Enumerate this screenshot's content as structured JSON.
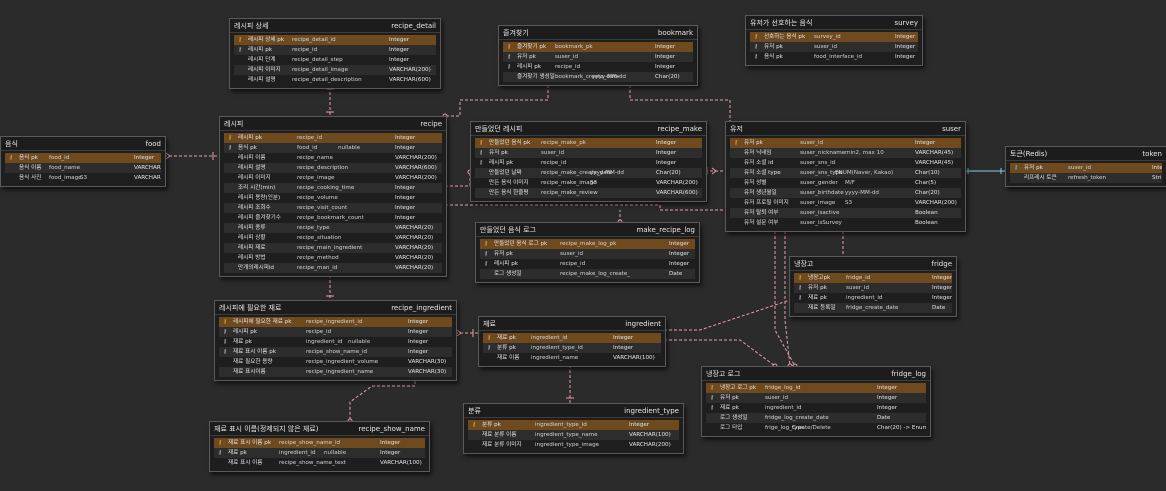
{
  "colors": {
    "background": "#2b2b2b",
    "table_bg": "#1e1e1e",
    "pk_row": "#6e4a1e",
    "relation_line": "#e8a0a8",
    "redis_line": "#7fd0dc"
  },
  "tables": [
    {
      "id": "recipe_detail",
      "title_ko": "레시피 상세",
      "title_en": "recipe_detail",
      "columns": [
        {
          "key": "pk",
          "name": "레시피 상세 pk",
          "col": "recipe_detail_id",
          "type": "Integer"
        },
        {
          "key": "fk",
          "name": "레시피 pk",
          "col": "recipe_id",
          "type": "Integer"
        },
        {
          "key": "",
          "name": "레시피 단계",
          "col": "recipe_detail_step",
          "type": "Integer"
        },
        {
          "key": "",
          "name": "레시피 이미지",
          "col": "recipe_detail_image",
          "type": "VARCHAR(200)"
        },
        {
          "key": "",
          "name": "레시피 설명",
          "col": "recipe_detail_description",
          "type": "VARCHAR(600)"
        }
      ]
    },
    {
      "id": "bookmark",
      "title_ko": "즐겨찾기",
      "title_en": "bookmark",
      "columns": [
        {
          "key": "pk",
          "name": "즐겨찾기 pk",
          "col": "bookmark_pk",
          "type": "Integer"
        },
        {
          "key": "fk",
          "name": "유저 pk",
          "col": "suser_id",
          "type": "Integer"
        },
        {
          "key": "fk",
          "name": "레시피 pk",
          "col": "recipe_id",
          "type": "Integer"
        },
        {
          "key": "",
          "name": "즐겨찾기 생성일",
          "col": "bookmark_create_date",
          "def": "yyyy-MM-dd",
          "type": "Char(20)"
        }
      ]
    },
    {
      "id": "survey",
      "title_ko": "유저가 선호하는 음식",
      "title_en": "survey",
      "columns": [
        {
          "key": "pk",
          "name": "선호하는 음식 pk",
          "col": "survey_id",
          "type": "Integer"
        },
        {
          "key": "fk",
          "name": "유저 pk",
          "col": "suser_id",
          "type": "Integer"
        },
        {
          "key": "fk",
          "name": "음식 pk",
          "col": "food_interface_id",
          "type": "Integer"
        }
      ]
    },
    {
      "id": "food",
      "title_ko": "음식",
      "title_en": "food",
      "columns": [
        {
          "key": "pk",
          "name": "음식 pk",
          "col": "food_id",
          "type": "Integer"
        },
        {
          "key": "",
          "name": "음식 이름",
          "col": "food_name",
          "type": "VARCHAR(200)"
        },
        {
          "key": "",
          "name": "음식 사진",
          "col": "food_image",
          "def": "S3",
          "type": "VARCHAR(200)"
        }
      ]
    },
    {
      "id": "recipe",
      "title_ko": "레시피",
      "title_en": "recipe",
      "columns": [
        {
          "key": "pk",
          "name": "레시피 pk",
          "col": "recipe_id",
          "type": "Integer"
        },
        {
          "key": "fk",
          "name": "음식 pk",
          "col": "food_id",
          "null": "nullable",
          "type": "Integer"
        },
        {
          "key": "",
          "name": "레시피 이름",
          "col": "recipe_name",
          "type": "VARCHAR(200)"
        },
        {
          "key": "",
          "name": "레시피 설명",
          "col": "recipe_description",
          "type": "VARCHAR(600)"
        },
        {
          "key": "",
          "name": "레시피 이미지",
          "col": "recipe_image",
          "type": "VARCHAR(200)"
        },
        {
          "key": "",
          "name": "조리 시간(min)",
          "col": "recipe_cooking_time",
          "type": "Integer"
        },
        {
          "key": "",
          "name": "레시피 용량(인분)",
          "col": "recipe_volume",
          "type": "Integer"
        },
        {
          "key": "",
          "name": "레시피 조회수",
          "col": "recipe_visit_count",
          "type": "Integer"
        },
        {
          "key": "",
          "name": "레시피 즐겨찾기수",
          "col": "recipe_bookmark_count",
          "type": "Integer"
        },
        {
          "key": "",
          "name": "레시피 종류",
          "col": "recipe_type",
          "type": "VARCHAR(20)"
        },
        {
          "key": "",
          "name": "레시피 상황",
          "col": "recipe_situation",
          "type": "VARCHAR(20)"
        },
        {
          "key": "",
          "name": "레시피 재료",
          "col": "recipe_main_ingredient",
          "type": "VARCHAR(20)"
        },
        {
          "key": "",
          "name": "레시피 방법",
          "col": "recipe_method",
          "type": "VARCHAR(20)"
        },
        {
          "key": "",
          "name": "만개의레시피id",
          "col": "recipe_man_id",
          "type": "VARCHAR(20)"
        }
      ]
    },
    {
      "id": "recipe_make",
      "title_ko": "만들었던 레시피",
      "title_en": "recipe_make",
      "columns": [
        {
          "key": "pk",
          "name": "만들었던 음식 pk",
          "col": "recipe_make_pk",
          "type": "Integer"
        },
        {
          "key": "fk",
          "name": "유저 pk",
          "col": "suser_id",
          "type": "Integer"
        },
        {
          "key": "fk",
          "name": "레시피 pk",
          "col": "recipe_id",
          "type": "Integer"
        },
        {
          "key": "",
          "name": "만들었던 날짜",
          "col": "recipe_make_create_date",
          "def": "yyyy-MM-dd",
          "type": "Char(20)"
        },
        {
          "key": "",
          "name": "만든 음식 이미지",
          "col": "recipe_make_image",
          "def": "S3",
          "type": "VARCHAR(200)"
        },
        {
          "key": "",
          "name": "만든 음식 한줄평",
          "col": "recipe_make_review",
          "type": "VARCHAR(600)"
        }
      ]
    },
    {
      "id": "suser",
      "title_ko": "유저",
      "title_en": "suser",
      "columns": [
        {
          "key": "pk",
          "name": "유저 pk",
          "col": "suser_id",
          "type": "Integer"
        },
        {
          "key": "",
          "name": "유저 닉네임",
          "col": "suser_nickname",
          "def": "min2, max 10",
          "type": "VARCHAR(45)"
        },
        {
          "key": "",
          "name": "유저 소셜 id",
          "col": "suser_sns_id",
          "type": "VARCHAR(45)"
        },
        {
          "key": "",
          "name": "유저 소셜 type",
          "col": "suser_sns_type",
          "def": "ENUM(Naver, Kakao)",
          "type": "Char(10)"
        },
        {
          "key": "",
          "name": "유저 성별",
          "col": "suser_gender",
          "def": "M/F",
          "type": "Char(5)"
        },
        {
          "key": "",
          "name": "유저 생년월일",
          "col": "suser_birthdate",
          "def": "yyyy-MM-dd",
          "type": "Char(20)"
        },
        {
          "key": "",
          "name": "유저 프로필 이미지",
          "col": "suser_image",
          "def": "S3",
          "type": "VARCHAR(200)"
        },
        {
          "key": "",
          "name": "유저 탈퇴 여부",
          "col": "suser_isactive",
          "type": "Boolean"
        },
        {
          "key": "",
          "name": "유저 설문 여부",
          "col": "suser_isSurvey",
          "type": "Boolean"
        }
      ]
    },
    {
      "id": "token",
      "title_ko": "토큰(Redis)",
      "title_en": "token",
      "columns": [
        {
          "key": "pf",
          "name": "유저 pk",
          "col": "suser_id",
          "type": "Integer"
        },
        {
          "key": "",
          "name": "리프레시 토큰",
          "col": "refresh_token",
          "type": "String"
        }
      ]
    },
    {
      "id": "make_recipe_log",
      "title_ko": "만들었던 음식 로그",
      "title_en": "make_recipe_log",
      "columns": [
        {
          "key": "pk",
          "name": "만들었던 음식 로그 pk",
          "col": "recipe_make_log_pk",
          "type": "Integer"
        },
        {
          "key": "fk",
          "name": "유저 pk",
          "col": "suser_id",
          "type": "Integer"
        },
        {
          "key": "fk",
          "name": "레시피 pk",
          "col": "recipe_id",
          "type": "Integer"
        },
        {
          "key": "",
          "name": "로그 생성일",
          "col": "recipe_make_log_create_date",
          "type": "Date"
        }
      ]
    },
    {
      "id": "fridge",
      "title_ko": "냉장고",
      "title_en": "fridge",
      "columns": [
        {
          "key": "pk",
          "name": "냉장고pk",
          "col": "fridge_id",
          "type": "Integer"
        },
        {
          "key": "fk",
          "name": "유저 pk",
          "col": "suser_id",
          "type": "Integer"
        },
        {
          "key": "fk",
          "name": "재료 pk",
          "col": "ingredient_id",
          "type": "Integer"
        },
        {
          "key": "",
          "name": "재료 등록일",
          "col": "fridge_create_date",
          "type": "Date"
        }
      ]
    },
    {
      "id": "recipe_ingredient",
      "title_ko": "레시피에 필요한 재료",
      "title_en": "recipe_ingredient",
      "columns": [
        {
          "key": "pk",
          "name": "레시피에 필요한 재료 pk",
          "col": "recipe_ingredient_id",
          "type": "Integer"
        },
        {
          "key": "fk",
          "name": "레시피 pk",
          "col": "recipe_id",
          "type": "Integer"
        },
        {
          "key": "fk",
          "name": "재료 pk",
          "col": "ingredient_id",
          "null": "nullable",
          "type": "Integer"
        },
        {
          "key": "fk",
          "name": "재료 표시 이름 pk",
          "col": "recipe_show_name_id",
          "type": "Integer"
        },
        {
          "key": "",
          "name": "재료 필요한 용량",
          "col": "recipe_ingredient_volume",
          "type": "VARCHAR(30)"
        },
        {
          "key": "",
          "name": "재료 표시이름",
          "col": "recipe_ingredient_name",
          "type": "VARCHAR(30)"
        }
      ]
    },
    {
      "id": "ingredient",
      "title_ko": "재료",
      "title_en": "ingredient",
      "columns": [
        {
          "key": "pk",
          "name": "재료 pk",
          "col": "ingredient_id",
          "type": "Integer"
        },
        {
          "key": "fk",
          "name": "분류 pk",
          "col": "ingredient_type_id",
          "type": "Integer"
        },
        {
          "key": "",
          "name": "재료 이름",
          "col": "ingredient_name",
          "type": "VARCHAR(100)"
        }
      ]
    },
    {
      "id": "fridge_log",
      "title_ko": "냉장고 로그",
      "title_en": "fridge_log",
      "columns": [
        {
          "key": "pk",
          "name": "냉장고 로그 pk",
          "col": "fridge_log_id",
          "type": "Integer"
        },
        {
          "key": "fk",
          "name": "유저 pk",
          "col": "suser_id",
          "type": "Integer"
        },
        {
          "key": "fk",
          "name": "재료 pk",
          "col": "ingredient_id",
          "type": "Integer"
        },
        {
          "key": "",
          "name": "로그 생성일",
          "col": "fridge_log_create_date",
          "type": "Date"
        },
        {
          "key": "",
          "name": "로그 타입",
          "col": "frige_log_type",
          "def": "Create/Delete",
          "type": "Char(20) -> Enum"
        }
      ]
    },
    {
      "id": "recipe_show_name",
      "title_ko": "재료 표시 이름(정제되지 않은 재료)",
      "title_en": "recipe_show_name",
      "columns": [
        {
          "key": "pk",
          "name": "재료 표시 이름 pk",
          "col": "recipe_show_name_id",
          "type": "Integer"
        },
        {
          "key": "fk",
          "name": "재료 pk",
          "col": "ingredient_id",
          "null": "nullable",
          "type": "Integer"
        },
        {
          "key": "",
          "name": "재료 표시 이름",
          "col": "recipe_show_name_text",
          "type": "VARCHAR(100)"
        }
      ]
    },
    {
      "id": "ingredient_type",
      "title_ko": "분류",
      "title_en": "ingredient_type",
      "columns": [
        {
          "key": "pk",
          "name": "분류 pk",
          "col": "ingredient_type_id",
          "type": "Integer"
        },
        {
          "key": "",
          "name": "재료 분류 이름",
          "col": "ingredient_type_name",
          "type": "VARCHAR(100)"
        },
        {
          "key": "",
          "name": "재료 분류 이미지",
          "col": "ingredient_type_image",
          "type": "VARCHAR(200)"
        }
      ]
    }
  ]
}
